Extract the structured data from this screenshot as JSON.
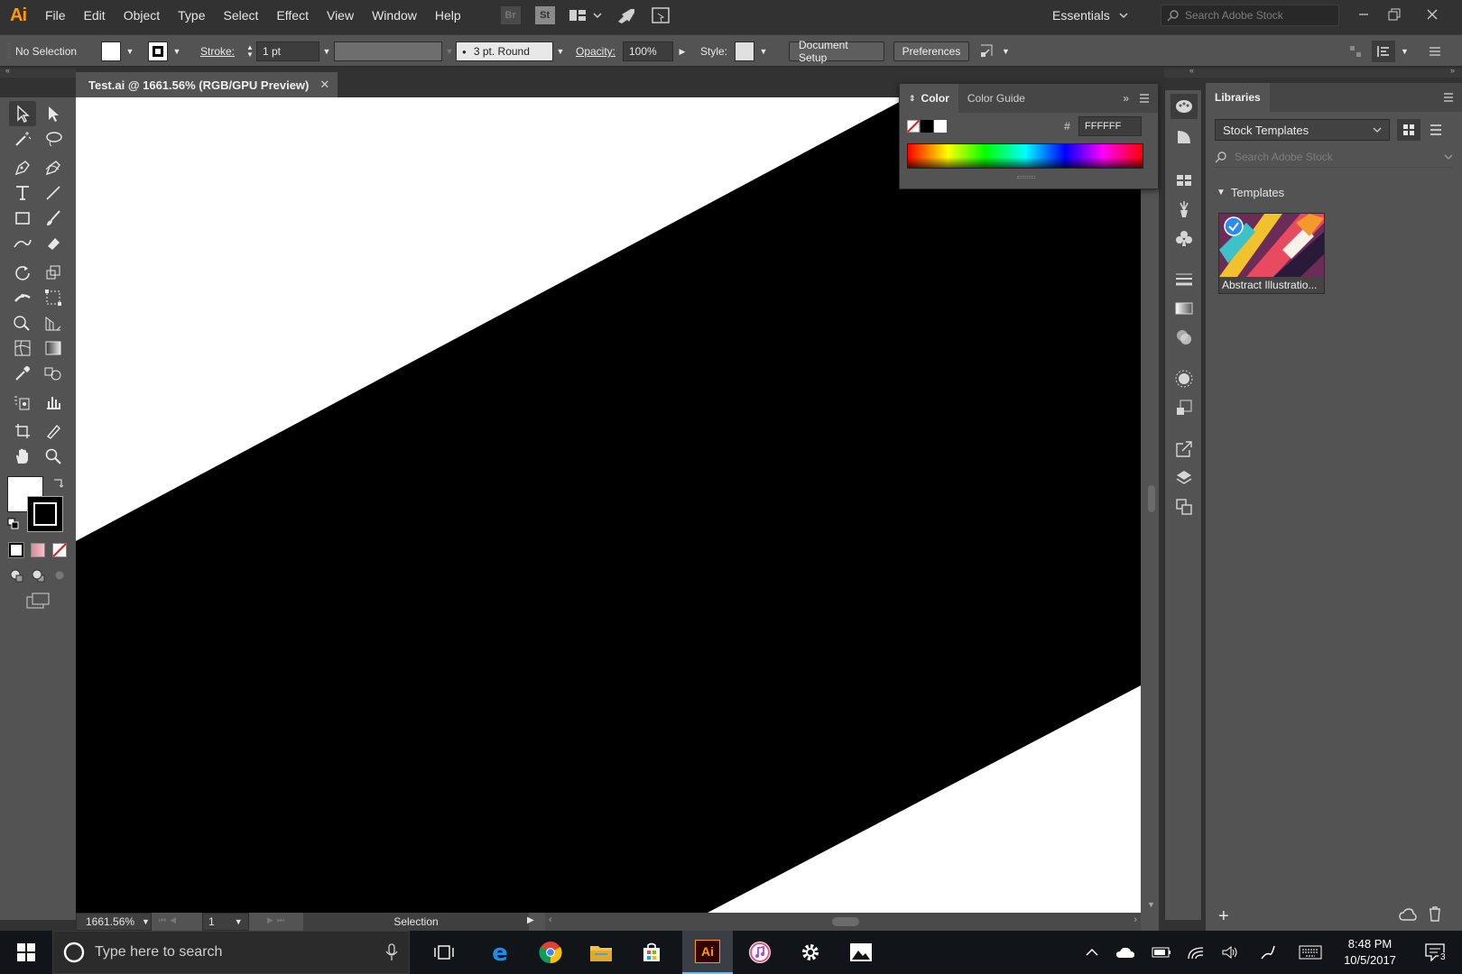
{
  "app": {
    "logo": "Ai",
    "menu": [
      "File",
      "Edit",
      "Object",
      "Type",
      "Select",
      "Effect",
      "View",
      "Window",
      "Help"
    ],
    "bridge_label": "Br",
    "stock_label": "St",
    "workspace": "Essentials",
    "search_placeholder": "Search Adobe Stock"
  },
  "control_bar": {
    "selection_label": "No Selection",
    "stroke_label": "Stroke:",
    "stroke_value": "1 pt",
    "brush_label": "3 pt. Round",
    "opacity_label": "Opacity:",
    "opacity_value": "100%",
    "style_label": "Style:",
    "document_setup": "Document Setup",
    "preferences": "Preferences"
  },
  "document": {
    "tab_title": "Test.ai @ 1661.56% (RGB/GPU Preview)",
    "zoom": "1661.56%",
    "artboard": "1",
    "status_mode": "Selection"
  },
  "color_panel": {
    "tabs": [
      "Color",
      "Color Guide"
    ],
    "hex_label": "#",
    "hex_value": "FFFFFF"
  },
  "libraries": {
    "title": "Libraries",
    "library_select": "Stock Templates",
    "search_placeholder": "Search Adobe Stock",
    "section": "Templates",
    "items": [
      {
        "label": "Abstract Illustratio..."
      }
    ]
  },
  "taskbar": {
    "search_placeholder": "Type here to search",
    "time": "8:48 PM",
    "date": "10/5/2017",
    "notification_count": "3"
  },
  "colors": {
    "ui_dark": "#323232",
    "ui_panel": "#535353",
    "ai_orange": "#ff9a00",
    "accent_blue": "#2d8ceb"
  }
}
